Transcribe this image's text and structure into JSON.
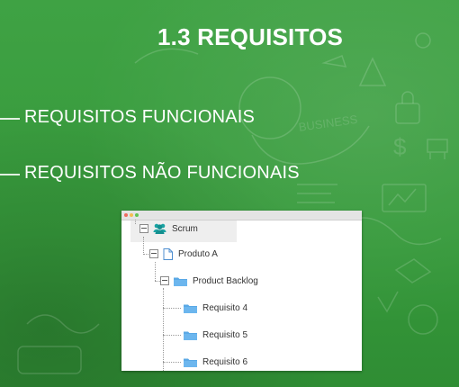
{
  "slide": {
    "title": "1.3 REQUISITOS",
    "bullets": [
      "REQUISITOS FUNCIONAIS",
      "REQUISITOS NÃO FUNCIONAIS"
    ],
    "background_watermark": "BUSINESS"
  },
  "tree": {
    "root": {
      "label": "Scrum",
      "icon": "users-icon"
    },
    "product": {
      "label": "Produto A",
      "icon": "document-icon"
    },
    "backlog": {
      "label": "Product Backlog",
      "icon": "folder-icon"
    },
    "requirements": [
      {
        "label": "Requisito 4",
        "icon": "folder-icon"
      },
      {
        "label": "Requisito 5",
        "icon": "folder-icon"
      },
      {
        "label": "Requisito 6",
        "icon": "folder-icon"
      }
    ]
  },
  "colors": {
    "background_green": "#3a9a3f",
    "text": "#ffffff",
    "folder_blue": "#5aa9e6",
    "users_teal": "#1aa3a3",
    "window_dot_red": "#ee6a5f",
    "window_dot_yellow": "#f5be4f",
    "window_dot_green": "#62c554"
  }
}
